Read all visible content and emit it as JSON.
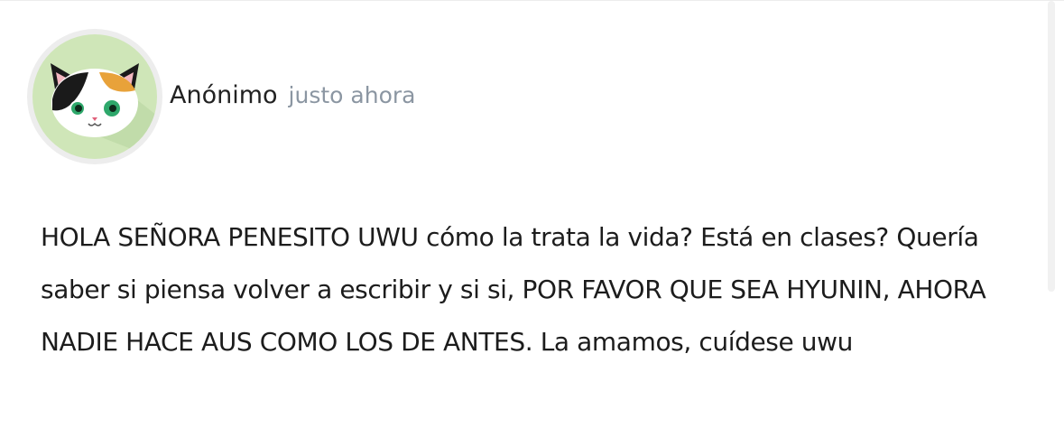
{
  "post": {
    "author": "Anónimo",
    "timestamp": "justo ahora",
    "avatar_icon": "calico-cat-face-icon",
    "message": "HOLA SEÑORA PENESITO UWU cómo la trata la vida? Está en clases? Quería saber si piensa volver a escribir y si si, POR FAVOR QUE SEA HYUNIN, AHORA NADIE HACE AUS COMO LOS DE ANTES. La amamos, cuídese uwu"
  },
  "colors": {
    "avatar_background": "#cfe6b8",
    "timestamp": "#8b96a2",
    "text": "#1c1c1c"
  }
}
